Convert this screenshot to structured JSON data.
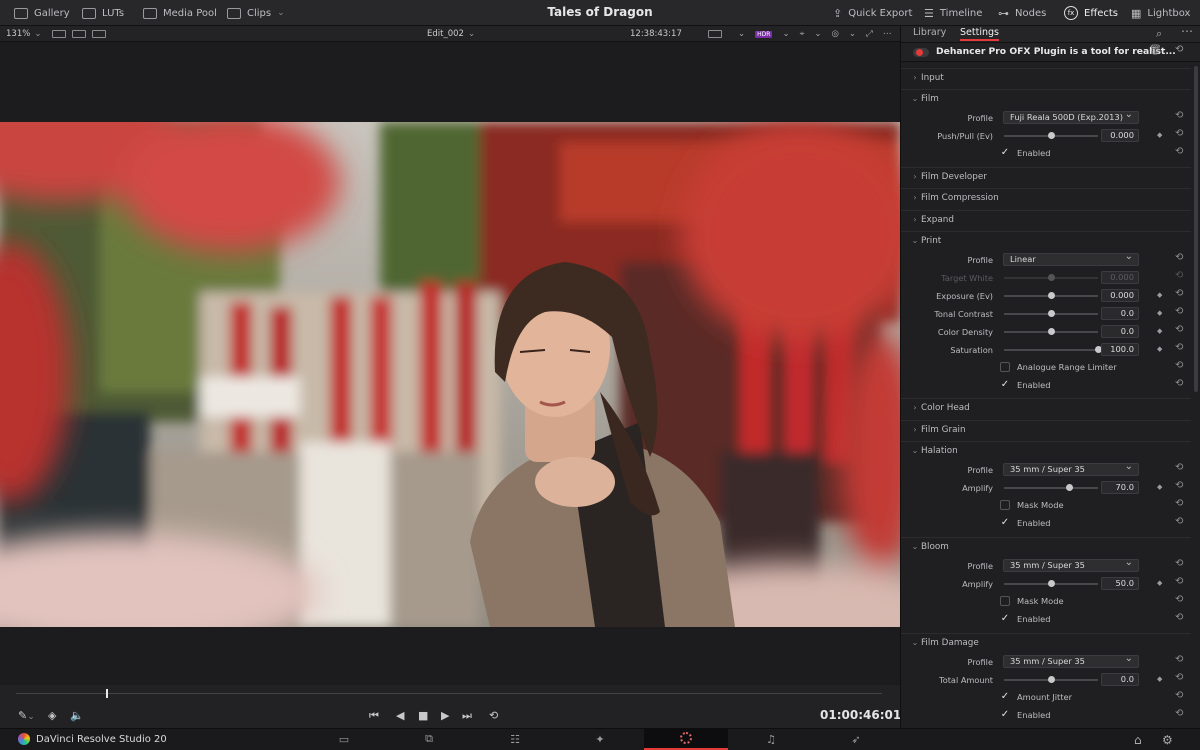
{
  "topbar": {
    "gallery": "Gallery",
    "luts": "LUTs",
    "media_pool": "Media Pool",
    "clips": "Clips",
    "title": "Tales of Dragon",
    "quick_export": "Quick Export",
    "timeline": "Timeline",
    "nodes": "Nodes",
    "effects": "Effects",
    "lightbox": "Lightbox"
  },
  "viewer": {
    "zoom": "131%",
    "clip_name": "Edit_002",
    "timecode": "12:38:43:17",
    "playhead_timecode": "01:00:46:01",
    "playhead_position": 0.105
  },
  "app": {
    "name": "DaVinci Resolve Studio 20"
  },
  "panel": {
    "tab_library": "Library",
    "tab_settings": "Settings",
    "plugin_title": "Dehancer Pro OFX Plugin is a tool for realist...",
    "sections": {
      "input": "Input",
      "film": "Film",
      "film_developer": "Film Developer",
      "film_compression": "Film Compression",
      "expand": "Expand",
      "print": "Print",
      "color_head": "Color Head",
      "film_grain": "Film Grain",
      "halation": "Halation",
      "bloom": "Bloom",
      "film_damage": "Film Damage"
    },
    "film": {
      "profile_label": "Profile",
      "profile_value": "Fuji Reala 500D (Exp.2013)",
      "push_pull_label": "Push/Pull (Ev)",
      "push_pull_value": "0.000",
      "push_pull_fraction": 0.5,
      "enabled_label": "Enabled"
    },
    "print": {
      "profile_label": "Profile",
      "profile_value": "Linear",
      "target_white_label": "Target White",
      "target_white_value": "0.000",
      "exposure_label": "Exposure (Ev)",
      "exposure_value": "0.000",
      "exposure_fraction": 0.5,
      "tonal_contrast_label": "Tonal Contrast",
      "tonal_contrast_value": "0.0",
      "tonal_contrast_fraction": 0.5,
      "color_density_label": "Color Density",
      "color_density_value": "0.0",
      "color_density_fraction": 0.5,
      "saturation_label": "Saturation",
      "saturation_value": "100.0",
      "saturation_fraction": 1.0,
      "analogue_label": "Analogue Range Limiter",
      "enabled_label": "Enabled"
    },
    "halation": {
      "profile_label": "Profile",
      "profile_value": "35 mm / Super 35",
      "amplify_label": "Amplify",
      "amplify_value": "70.0",
      "amplify_fraction": 0.7,
      "mask_label": "Mask Mode",
      "enabled_label": "Enabled"
    },
    "bloom": {
      "profile_label": "Profile",
      "profile_value": "35 mm / Super 35",
      "amplify_label": "Amplify",
      "amplify_value": "50.0",
      "amplify_fraction": 0.5,
      "mask_label": "Mask Mode",
      "enabled_label": "Enabled"
    },
    "film_damage": {
      "profile_label": "Profile",
      "profile_value": "35 mm / Super 35",
      "total_amount_label": "Total Amount",
      "total_amount_value": "0.0",
      "total_amount_fraction": 0.5,
      "amount_jitter_label": "Amount Jitter",
      "enabled_label": "Enabled"
    }
  },
  "colors": {
    "accent": "#e53a3a",
    "bg": "#1e1e20"
  }
}
